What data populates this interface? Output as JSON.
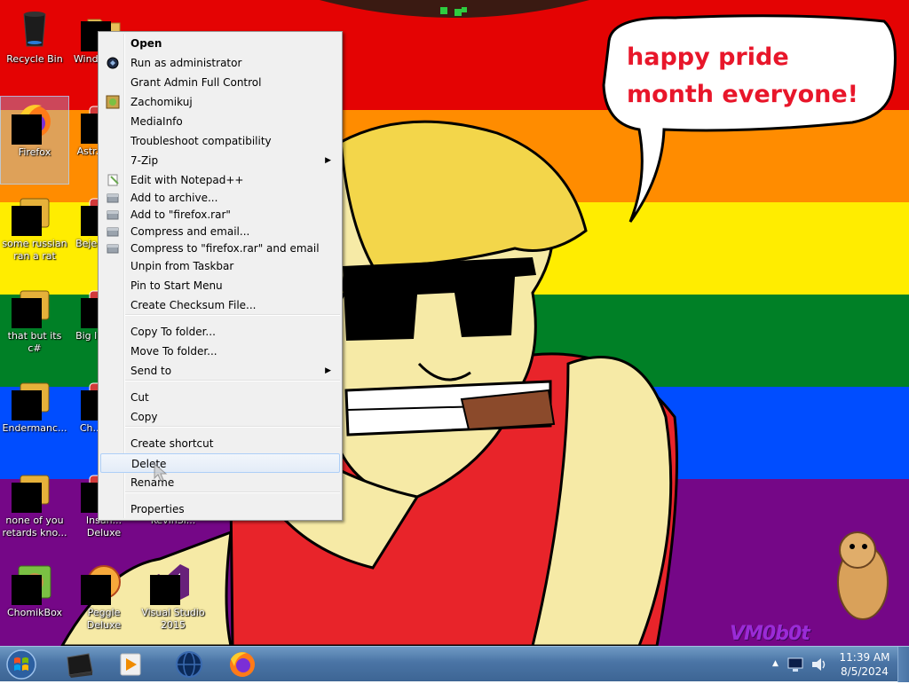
{
  "colors": {
    "stripes": [
      "#e40303",
      "#ff8c00",
      "#ffed00",
      "#008026",
      "#004dff",
      "#750787"
    ],
    "menu_bg": "#f0f0f0",
    "highlight_border": "#aecff7",
    "bubble_text": "#e8162a"
  },
  "wallpaper": {
    "speech_bubble": "happy pride month everyone!",
    "watermark": "VM0b0t"
  },
  "desktop_icons": [
    {
      "label": "Recycle Bin",
      "icon": "recycle-bin-icon"
    },
    {
      "label": "Windo... M...",
      "icon": "folder-icon"
    },
    {
      "label": "Firefox",
      "icon": "firefox-icon"
    },
    {
      "label": "Astr... De...",
      "icon": "game-icon"
    },
    {
      "label": "some russian ran a rat",
      "icon": "app-icon"
    },
    {
      "label": "Beje... De...",
      "icon": "game-icon"
    },
    {
      "label": "that but its c#",
      "icon": "app-icon"
    },
    {
      "label": "Big l... De...",
      "icon": "game-icon"
    },
    {
      "label": "Endermanc...",
      "icon": "app-icon"
    },
    {
      "label": "Ch... De...",
      "icon": "game-icon"
    },
    {
      "label": "none of you retards kno...",
      "icon": "app-icon"
    },
    {
      "label": "Insan... Deluxe",
      "icon": "game-icon"
    },
    {
      "label": "KevinSi...",
      "icon": "app-icon"
    },
    {
      "label": "ChomikBox",
      "icon": "chomikbox-icon"
    },
    {
      "label": "Peggle Deluxe",
      "icon": "peggle-icon"
    },
    {
      "label": "Visual Studio 2015",
      "icon": "visual-studio-icon"
    }
  ],
  "context_menu": {
    "items": [
      {
        "label": "Open",
        "bold": true
      },
      {
        "label": "Run as administrator",
        "icon": "shield-icon"
      },
      {
        "label": "Grant Admin Full Control"
      },
      {
        "label": "Zachomikuj",
        "icon": "chomik-icon"
      },
      {
        "label": "MediaInfo"
      },
      {
        "label": "Troubleshoot compatibility"
      },
      {
        "label": "7-Zip",
        "submenu": true
      },
      {
        "label": "Edit with Notepad++",
        "icon": "notepad-icon"
      },
      {
        "label": "Add to archive...",
        "icon": "winrar-icon"
      },
      {
        "label": "Add to \"firefox.rar\"",
        "icon": "winrar-icon"
      },
      {
        "label": "Compress and email...",
        "icon": "winrar-icon"
      },
      {
        "label": "Compress to \"firefox.rar\" and email",
        "icon": "winrar-icon"
      },
      {
        "label": "Unpin from Taskbar"
      },
      {
        "label": "Pin to Start Menu"
      },
      {
        "label": "Create Checksum File..."
      },
      {
        "label": "Copy To folder..."
      },
      {
        "label": "Move To folder..."
      },
      {
        "label": "Send to",
        "submenu": true
      },
      {
        "label": "Cut"
      },
      {
        "label": "Copy"
      },
      {
        "label": "Create shortcut"
      },
      {
        "label": "Delete",
        "highlighted": true
      },
      {
        "label": "Rename"
      },
      {
        "label": "Properties"
      }
    ]
  },
  "taskbar": {
    "pinned": [
      "terminal-icon",
      "media-player-icon",
      "globe-icon",
      "firefox-icon"
    ],
    "clock_time": "11:39 AM",
    "clock_date": "8/5/2024"
  }
}
